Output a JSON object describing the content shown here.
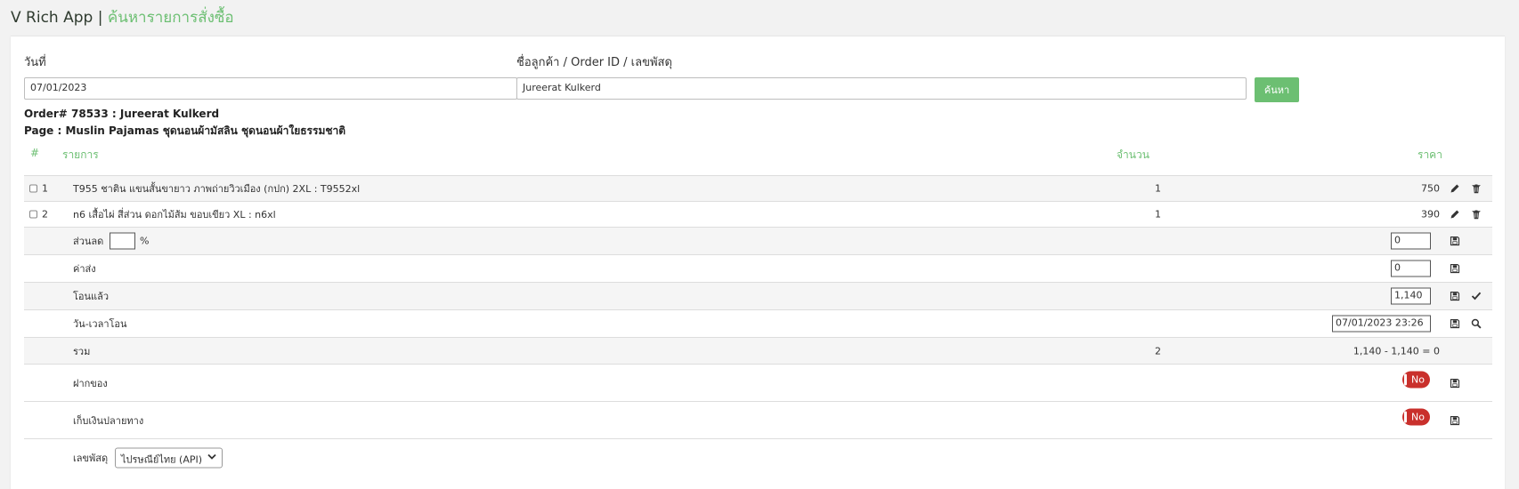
{
  "header": {
    "app_name": "V Rich App |",
    "page_title": "ค้นหารายการสั่งซื้อ"
  },
  "search": {
    "date_label": "วันที่",
    "date_value": "07/01/2023",
    "customer_label": "ชื่อลูกค้า / Order ID / เลขพัสดุ",
    "customer_value": "Jureerat Kulkerd",
    "search_button": "ค้นหา"
  },
  "order": {
    "order_line": "Order# 78533 : Jureerat Kulkerd",
    "page_line": "Page : Muslin Pajamas ชุดนอนผ้ามัสลิน ชุดนอนผ้าใยธรรมชาติ"
  },
  "table": {
    "headers": {
      "num": "#",
      "item": "รายการ",
      "qty": "จำนวน",
      "price": "ราคา"
    },
    "items": [
      {
        "no": "1",
        "desc": "T955 ชาติน แขนสั้นขายาว ภาพถ่ายวิวเมือง (กปก) 2XL : T9552xl",
        "qty": "1",
        "price": "750"
      },
      {
        "no": "2",
        "desc": "n6 เสื้อไผ่ สี่ส่วน ดอกไม้ส้ม ขอบเขียว XL : n6xl",
        "qty": "1",
        "price": "390"
      }
    ]
  },
  "summary": {
    "discount_label": "ส่วนลด",
    "discount_pct_symbol": "%",
    "discount_value": "0",
    "shipping_label": "ค่าส่ง",
    "shipping_value": "0",
    "transferred_label": "โอนแล้ว",
    "transferred_value": "1,140",
    "transfer_time_label": "วัน-เวลาโอน",
    "transfer_time_value": "07/01/2023 23:26",
    "total_label": "รวม",
    "total_qty": "2",
    "total_calc": "1,140 - 1,140 = 0",
    "deposit_label": "ฝากของ",
    "deposit_toggle": "No",
    "cod_label": "เก็บเงินปลายทาง",
    "cod_toggle": "No",
    "tracking_label": "เลขพัสดุ",
    "tracking_select": "ไปรษณีย์ไทย (API)"
  },
  "colors": {
    "accent": "#6cbf72",
    "toggle_off": "#c9302c"
  },
  "icons": [
    "pencil-icon",
    "trash-icon",
    "save-icon",
    "check-icon",
    "search-icon",
    "chevron-down-icon"
  ]
}
